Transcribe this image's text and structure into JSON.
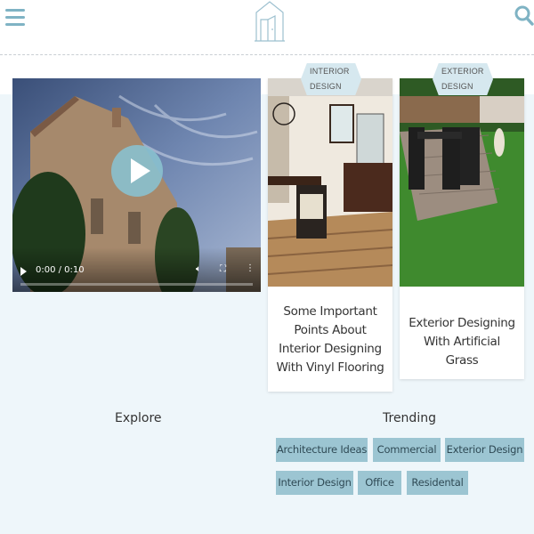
{
  "header": {
    "menu_icon": "hamburger-menu-icon",
    "logo_icon": "house-door-logo",
    "search_icon": "search-icon",
    "accent_color": "#7fb3c4"
  },
  "video": {
    "time_display": "0:00 / 0:10",
    "progress": 0,
    "icons": [
      "play-icon",
      "volume-icon",
      "fullscreen-icon",
      "more-options-icon"
    ]
  },
  "cards": [
    {
      "category": "INTERIOR DESIGN",
      "title": "Some Important Points About Interior Designing With Vinyl Flooring"
    },
    {
      "category": "EXTERIOR DESIGN",
      "title": "Exterior Designing With Artificial Grass"
    }
  ],
  "footer": {
    "explore_title": "Explore",
    "trending_title": "Trending",
    "tags": [
      "Architecture Ideas",
      "Commercial",
      "Exterior Design",
      "Interior Design",
      "Office",
      "Residental"
    ]
  },
  "colors": {
    "band_background": "#eef6fa",
    "tag_background": "#9cc5d2",
    "badge_background": "#d6e8ef"
  }
}
